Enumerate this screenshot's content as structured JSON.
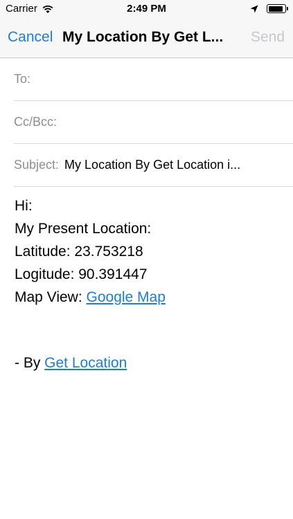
{
  "status_bar": {
    "carrier": "Carrier",
    "time": "2:49 PM",
    "battery_level": 0.9
  },
  "nav": {
    "cancel_label": "Cancel",
    "title": "My Location By Get L...",
    "send_label": "Send"
  },
  "fields": {
    "to_label": "To:",
    "cc_label": "Cc/Bcc:",
    "subject_label": "Subject:",
    "subject_value": "My Location By Get Location i..."
  },
  "body": {
    "greeting": "Hi:",
    "intro": "My Present Location:",
    "latitude": "Latitude: 23.753218",
    "longitude": "Logitude: 90.391447",
    "map_prefix": "Map View: ",
    "map_link": "Google Map",
    "signature_prefix": "- By ",
    "signature_link": "Get Location"
  },
  "colors": {
    "accent": "#1a7de0",
    "disabled": "#c7c7cc",
    "label": "#8e8e93"
  }
}
